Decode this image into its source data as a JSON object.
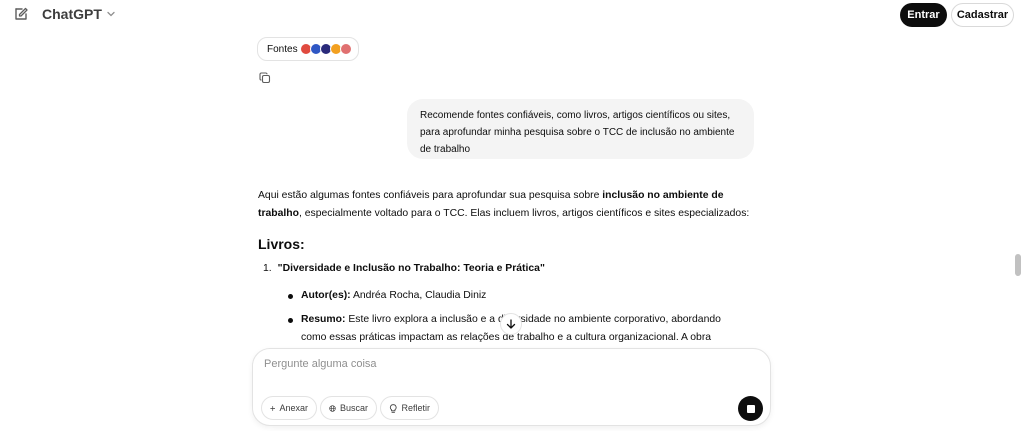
{
  "header": {
    "model_name": "ChatGPT",
    "login_label": "Entrar",
    "signup_label": "Cadastrar"
  },
  "sources": {
    "label": "Fontes"
  },
  "user_message": "Recomende fontes confiáveis, como livros, artigos científicos ou sites, para aprofundar minha pesquisa sobre o TCC de inclusão no ambiente de trabalho",
  "answer": {
    "intro_part1": "Aqui estão algumas fontes confiáveis para aprofundar sua pesquisa sobre ",
    "intro_bold": "inclusão no ambiente de trabalho",
    "intro_part2": ", especialmente voltado para o TCC. Elas incluem livros, artigos científicos e sites especializados:",
    "section_heading": "Livros:",
    "items": [
      {
        "number": "1.",
        "title": "\"Diversidade e Inclusão no Trabalho: Teoria e Prática\"",
        "author_label": "Autor(es):",
        "author_value": " Andréa Rocha, Claudia Diniz",
        "summary_label": "Resumo:",
        "summary_value": " Este livro explora a inclusão e a diversidade no ambiente corporativo, abordando como essas práticas impactam as relações de trabalho e a cultura organizacional. A obra"
      }
    ]
  },
  "composer": {
    "placeholder": "Pergunte alguma coisa",
    "attach_label": "Anexar",
    "search_label": "Buscar",
    "reason_label": "Refletir"
  },
  "colors": {
    "primary_button": "#0d0d0d",
    "bubble_bg": "#f4f4f4"
  }
}
